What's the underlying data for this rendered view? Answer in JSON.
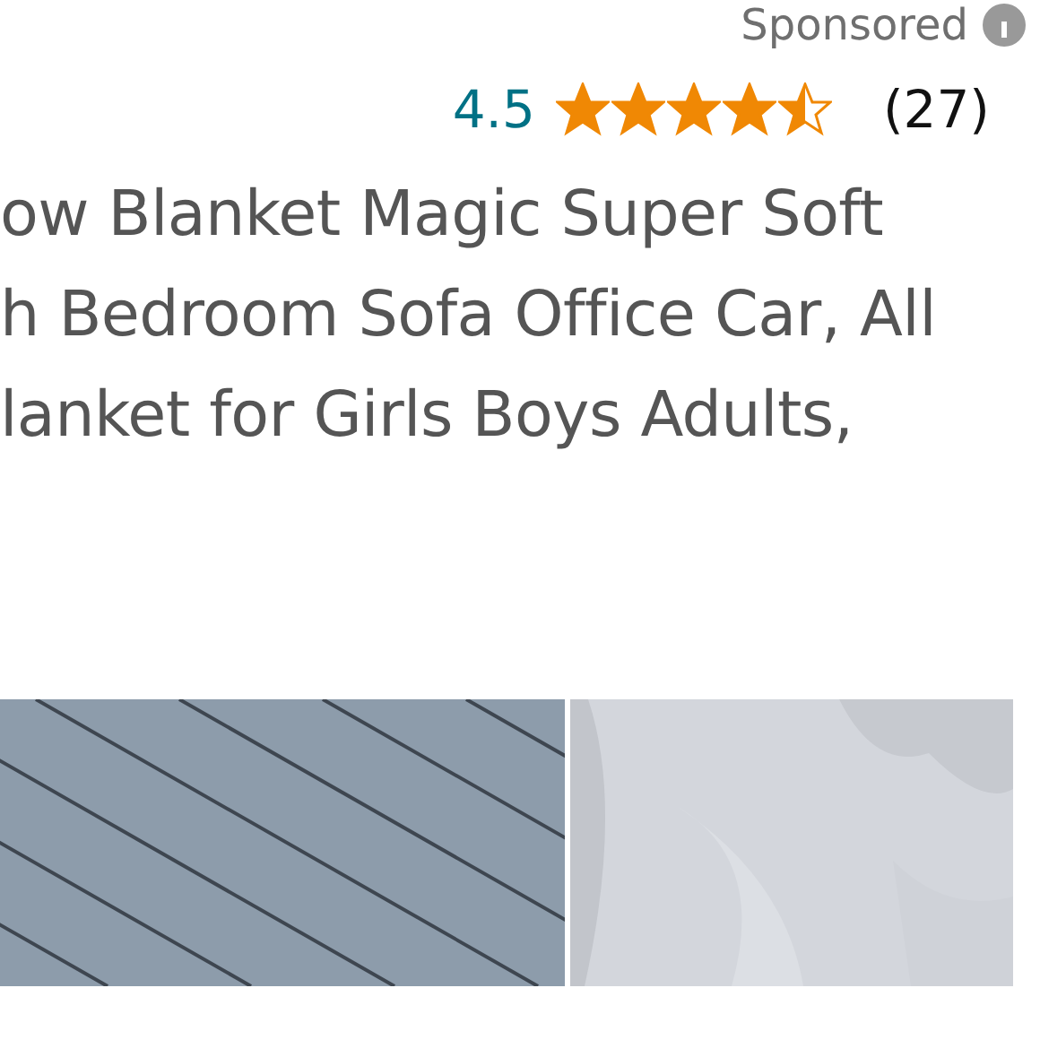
{
  "sponsored": {
    "label": "Sponsored"
  },
  "rating": {
    "value": "4.5",
    "stars": 4.5,
    "count": "(27)"
  },
  "title_lines": [
    "ow Blanket Magic Super Soft",
    "h Bedroom Sofa Office Car, All",
    "lanket for Girls Boys Adults,"
  ]
}
